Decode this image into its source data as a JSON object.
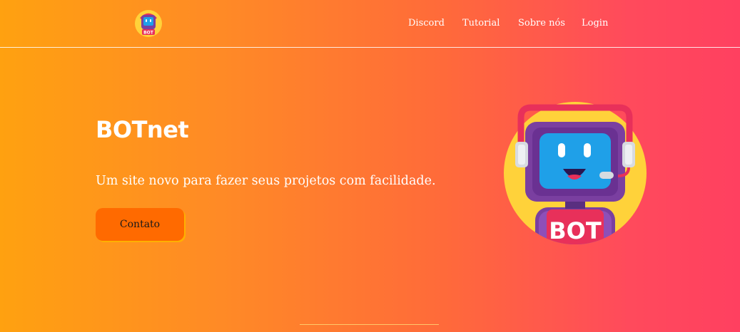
{
  "header": {
    "logo_text": "BOT",
    "nav": [
      {
        "label": "Discord"
      },
      {
        "label": "Tutorial"
      },
      {
        "label": "Sobre nós"
      },
      {
        "label": "Login"
      }
    ]
  },
  "hero": {
    "title": "BOTnet",
    "subtitle": "Um site novo para fazer seus projetos com facilidade.",
    "cta_label": "Contato",
    "illustration_text": "BOT"
  },
  "colors": {
    "gradient_start": "#ffa110",
    "gradient_end": "#ff4060",
    "button": "#ff6a00",
    "bot_purple": "#7a3fa0",
    "bot_screen": "#1fa0e8",
    "bot_badge": "#e8305a",
    "bot_bg_circle": "#ffd23a"
  }
}
